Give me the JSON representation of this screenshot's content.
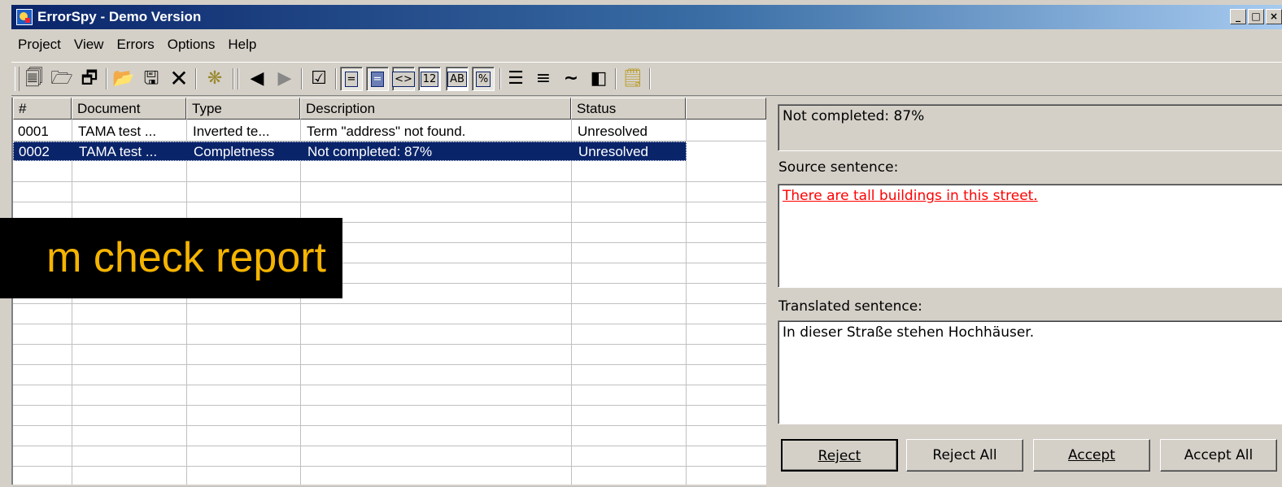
{
  "window": {
    "title": "ErrorSpy - Demo Version",
    "controls": [
      "_",
      "□",
      "×"
    ]
  },
  "menu": [
    "Project",
    "View",
    "Errors",
    "Options",
    "Help"
  ],
  "toolbar": {
    "icons": [
      "properties-icon",
      "open-project-icon",
      "copy-icon",
      "open-folder-icon",
      "save-icon",
      "delete-icon",
      "run-check-icon",
      "previous-icon",
      "next-icon",
      "check-icon",
      "view-equal-icon",
      "view-filled-icon",
      "tags-icon",
      "numbers-icon",
      "case-icon",
      "percent-icon",
      "list-icon",
      "align-icon",
      "tilde-icon",
      "split-icon",
      "notes-icon"
    ],
    "box_labels": {
      "tags": "<>",
      "numbers": "12",
      "case": "AB",
      "percent": "%"
    }
  },
  "table": {
    "columns": [
      "#",
      "Document",
      "Type",
      "Description",
      "Status"
    ],
    "rows": [
      {
        "num": "0001",
        "document": "TAMA test ...",
        "type": "Inverted te...",
        "description": "Term \"address\" not found.",
        "status": "Unresolved"
      },
      {
        "num": "0002",
        "document": "TAMA test ...",
        "type": "Completness",
        "description": "Not completed: 87%",
        "status": "Unresolved"
      }
    ],
    "selected_row": 1
  },
  "overlay_caption": "m check report",
  "detail": {
    "summary": "Not completed: 87%",
    "source_label": "Source sentence:",
    "source_text": "There are tall buildings in this street.",
    "translated_label": "Translated sentence:",
    "translated_text": "In dieser Straße stehen Hochhäuser.",
    "source_color": "#ff0000"
  },
  "buttons": {
    "reject": "Reject",
    "reject_all": "Reject All",
    "accept": "Accept",
    "accept_all": "Accept All"
  }
}
